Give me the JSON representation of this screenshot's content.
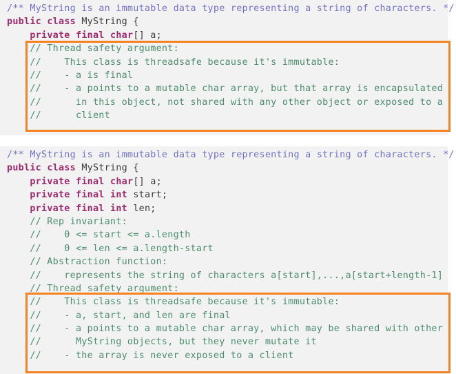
{
  "blocks": [
    {
      "name": "code-block-1",
      "lines": [
        [
          {
            "t": "javadoc",
            "s": "/** MyString is an immutable data type representing a string of characters. */"
          }
        ],
        [
          {
            "t": "keyword",
            "s": "public"
          },
          {
            "t": "plain",
            "s": " "
          },
          {
            "t": "keyword",
            "s": "class"
          },
          {
            "t": "plain",
            "s": " "
          },
          {
            "t": "ident",
            "s": "MyString"
          },
          {
            "t": "plain",
            "s": " {"
          }
        ],
        [
          {
            "t": "plain",
            "s": "    "
          },
          {
            "t": "keyword",
            "s": "private"
          },
          {
            "t": "plain",
            "s": " "
          },
          {
            "t": "keyword",
            "s": "final"
          },
          {
            "t": "plain",
            "s": " "
          },
          {
            "t": "type",
            "s": "char"
          },
          {
            "t": "plain",
            "s": "[] a;"
          }
        ],
        [
          {
            "t": "comment",
            "s": "    // Thread safety argument:"
          }
        ],
        [
          {
            "t": "comment",
            "s": "    //    This class is threadsafe because it's immutable:"
          }
        ],
        [
          {
            "t": "comment",
            "s": "    //    - a is final"
          }
        ],
        [
          {
            "t": "comment",
            "s": "    //    - a points to a mutable char array, but that array is encapsulated"
          }
        ],
        [
          {
            "t": "comment",
            "s": "    //      in this object, not shared with any other object or exposed to a"
          }
        ],
        [
          {
            "t": "comment",
            "s": "    //      client"
          }
        ]
      ]
    },
    {
      "name": "code-block-2",
      "lines": [
        [
          {
            "t": "javadoc",
            "s": "/** MyString is an immutable data type representing a string of characters. */"
          }
        ],
        [
          {
            "t": "keyword",
            "s": "public"
          },
          {
            "t": "plain",
            "s": " "
          },
          {
            "t": "keyword",
            "s": "class"
          },
          {
            "t": "plain",
            "s": " "
          },
          {
            "t": "ident",
            "s": "MyString"
          },
          {
            "t": "plain",
            "s": " {"
          }
        ],
        [
          {
            "t": "plain",
            "s": "    "
          },
          {
            "t": "keyword",
            "s": "private"
          },
          {
            "t": "plain",
            "s": " "
          },
          {
            "t": "keyword",
            "s": "final"
          },
          {
            "t": "plain",
            "s": " "
          },
          {
            "t": "type",
            "s": "char"
          },
          {
            "t": "plain",
            "s": "[] a;"
          }
        ],
        [
          {
            "t": "plain",
            "s": "    "
          },
          {
            "t": "keyword",
            "s": "private"
          },
          {
            "t": "plain",
            "s": " "
          },
          {
            "t": "keyword",
            "s": "final"
          },
          {
            "t": "plain",
            "s": " "
          },
          {
            "t": "type",
            "s": "int"
          },
          {
            "t": "plain",
            "s": " start;"
          }
        ],
        [
          {
            "t": "plain",
            "s": "    "
          },
          {
            "t": "keyword",
            "s": "private"
          },
          {
            "t": "plain",
            "s": " "
          },
          {
            "t": "keyword",
            "s": "final"
          },
          {
            "t": "plain",
            "s": " "
          },
          {
            "t": "type",
            "s": "int"
          },
          {
            "t": "plain",
            "s": " len;"
          }
        ],
        [
          {
            "t": "comment",
            "s": "    // Rep invariant:"
          }
        ],
        [
          {
            "t": "comment",
            "s": "    //    0 <= start <= a.length"
          }
        ],
        [
          {
            "t": "comment",
            "s": "    //    0 <= len <= a.length-start"
          }
        ],
        [
          {
            "t": "comment",
            "s": "    // Abstraction function:"
          }
        ],
        [
          {
            "t": "comment",
            "s": "    //    represents the string of characters a[start],...,a[start+length-1]"
          }
        ],
        [
          {
            "t": "comment",
            "s": "    // Thread safety argument:"
          }
        ],
        [
          {
            "t": "comment",
            "s": "    //    This class is threadsafe because it's immutable:"
          }
        ],
        [
          {
            "t": "comment",
            "s": "    //    - a, start, and len are final"
          }
        ],
        [
          {
            "t": "comment",
            "s": "    //    - a points to a mutable char array, which may be shared with other"
          }
        ],
        [
          {
            "t": "comment",
            "s": "    //      MyString objects, but they never mutate it"
          }
        ],
        [
          {
            "t": "comment",
            "s": "    //    - the array is never exposed to a client"
          }
        ]
      ]
    }
  ],
  "highlights": [
    {
      "name": "thread-safety-argument-highlight-1",
      "color": "#f58220",
      "annotates": "Thread safety argument comment in first MyString code block"
    },
    {
      "name": "thread-safety-argument-highlight-2",
      "color": "#f58220",
      "annotates": "Thread safety argument comment in second MyString code block"
    }
  ],
  "theme": {
    "code_background": "#f2f2f2",
    "page_background": "#ffffff",
    "javadoc_color": "#7272c8",
    "keyword_color": "#9e2a6e",
    "comment_color": "#4c8d6e",
    "identifier_color": "#3a3a3a",
    "highlight_color": "#f58220"
  }
}
